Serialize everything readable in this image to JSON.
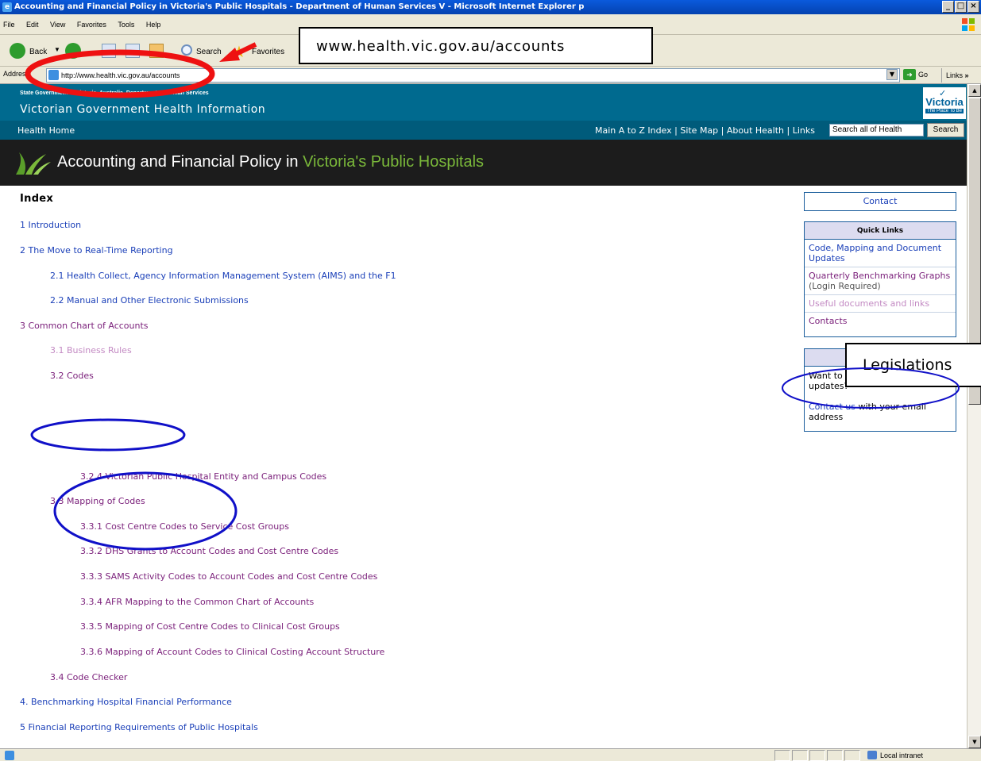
{
  "window": {
    "title": "Accounting and Financial Policy in Victoria's Public Hospitals - Department of Human Services V - Microsoft Internet Explorer p"
  },
  "menu": [
    "File",
    "Edit",
    "View",
    "Favorites",
    "Tools",
    "Help"
  ],
  "toolbar": {
    "back_label": "Back",
    "search_label": "Search",
    "favorites_label": "Favorites"
  },
  "addressbar": {
    "label": "Address",
    "url": "http://www.health.vic.gov.au/accounts",
    "go_label": "Go",
    "links_label": "Links"
  },
  "site": {
    "state_line": "State Government of Victoria, Australia, Department of Human Services",
    "site_title": "Victorian Government Health Information",
    "logo_word": "Victoria",
    "logo_tagline": "The Place To Be",
    "nav_home": "Health Home",
    "nav_links": "Main A to Z Index | Site Map | About Health | Links",
    "search_placeholder": "Search all of Health",
    "search_button": "Search"
  },
  "banner": {
    "title_part1": "Accounting and Financial Policy in ",
    "title_part2": "Victoria's Public Hospitals"
  },
  "index": {
    "title": "Index",
    "items": [
      {
        "label": "1 Introduction"
      },
      {
        "label": "2 The Move to Real-Time Reporting"
      },
      {
        "label": "2.1 Health Collect, Agency Information Management System (AIMS) and the F1"
      },
      {
        "label": "2.2 Manual and Other Electronic Submissions"
      },
      {
        "label": "3 Common Chart of Accounts"
      },
      {
        "label": "3.1 Business Rules"
      },
      {
        "label": "3.2 Codes"
      },
      {
        "label": "3.2.4 Victorian Public Hospital Entity and Campus Codes"
      },
      {
        "label": "3.3 Mapping of Codes"
      },
      {
        "label": "3.3.1 Cost Centre Codes to Service Cost Groups"
      },
      {
        "label": "3.3.2 DHS Grants to Account Codes and Cost Centre Codes"
      },
      {
        "label": "3.3.3 SAMS Activity Codes to Account Codes and Cost Centre Codes"
      },
      {
        "label": "3.3.4 AFR Mapping to the Common Chart of Accounts"
      },
      {
        "label": "3.3.5 Mapping of Cost Centre Codes to Clinical Cost Groups"
      },
      {
        "label": "3.3.6 Mapping of Account Codes to Clinical Costing Account Structure"
      },
      {
        "label": "3.4 Code Checker"
      },
      {
        "label": "4. Benchmarking Hospital Financial Performance"
      },
      {
        "label": "5 Financial Reporting Requirements of Public Hospitals"
      }
    ]
  },
  "sidebar": {
    "contact": "Contact",
    "quick_links_title": "Quick Links",
    "quick_links": [
      {
        "label": "Code, Mapping and Document Updates"
      },
      {
        "label": "Quarterly Benchmarking Graphs",
        "note": "(Login Required)"
      },
      {
        "label": "Useful documents and links"
      },
      {
        "label": "Contacts"
      }
    ],
    "updates_text": "Want to know about website updates?",
    "updates_link": "Contact us",
    "updates_text2": " with your email address"
  },
  "annotations": {
    "url_callout": "www.health.vic.gov.au/accounts",
    "legislations_callout": "Legislations"
  },
  "statusbar": {
    "zone": "Local intranet"
  },
  "colors": {
    "site_blue": "#006a8f",
    "link_blue": "#1a3fb8",
    "visited_purple": "#7a1f7a",
    "annotation_red": "#ee1111",
    "annotation_blue": "#1010c8"
  }
}
